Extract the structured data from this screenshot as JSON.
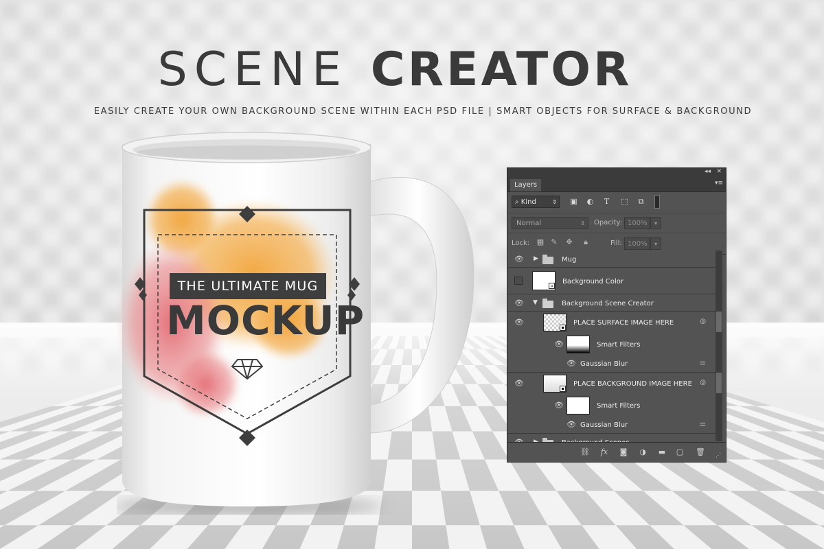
{
  "header": {
    "title_light": "SCENE",
    "title_bold": "CREATOR",
    "subtitle": "EASILY CREATE YOUR OWN BACKGROUND SCENE WITHIN EACH PSD FILE | SMART OBJECTS FOR SURFACE & BACKGROUND"
  },
  "mug": {
    "tagline": "THE ULTIMATE MUG",
    "headline": "MOCKUP",
    "emblem_icon": "diamond-icon"
  },
  "layers_panel": {
    "tab_label": "Layers",
    "filter": {
      "kind_label": "Kind",
      "filter_icons": [
        "image-filter-icon",
        "adjustment-filter-icon",
        "type-filter-icon",
        "shape-filter-icon",
        "smart-object-filter-icon"
      ]
    },
    "blend_mode": "Normal",
    "opacity_label": "Opacity:",
    "opacity_value": "100%",
    "lock_label": "Lock:",
    "fill_label": "Fill:",
    "fill_value": "100%",
    "layers": [
      {
        "name": "Mug",
        "type": "group",
        "collapsed": true,
        "visible": true
      },
      {
        "name": "Background Color",
        "type": "fill",
        "visible": false
      },
      {
        "name": "Background Scene Creator",
        "type": "group",
        "collapsed": false,
        "visible": true
      },
      {
        "name": "PLACE SURFACE IMAGE HERE",
        "type": "smart-object",
        "visible": true
      },
      {
        "name": "Smart Filters",
        "type": "smart-filters",
        "visible": true
      },
      {
        "name": "Gaussian Blur",
        "type": "filter",
        "visible": true
      },
      {
        "name": "PLACE BACKGROUND IMAGE HERE",
        "type": "smart-object",
        "visible": true
      },
      {
        "name": "Smart Filters",
        "type": "smart-filters",
        "visible": true
      },
      {
        "name": "Gaussian Blur",
        "type": "filter",
        "visible": true
      },
      {
        "name": "Background Scenes",
        "type": "group",
        "collapsed": true,
        "visible": true
      }
    ],
    "bottom_icons": [
      "link-layers-icon",
      "fx-icon",
      "add-mask-icon",
      "adjustment-layer-icon",
      "new-group-icon",
      "new-layer-icon",
      "delete-layer-icon"
    ]
  },
  "colors": {
    "text_dark": "#3a3a3a",
    "panel_bg": "#535353",
    "panel_dark": "#3b3b3b",
    "mug_splash_orange": "#f0a640",
    "mug_splash_pink": "#e4727a"
  }
}
